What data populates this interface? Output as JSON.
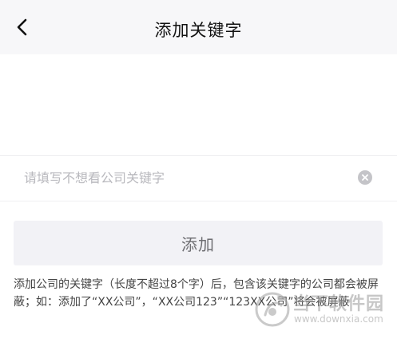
{
  "header": {
    "title": "添加关键字",
    "back_icon": "chevron-left-icon"
  },
  "keyword_input": {
    "value": "",
    "placeholder": "请填写不想看公司关键字",
    "clear_icon": "clear-circle-icon"
  },
  "add_button": {
    "label": "添加"
  },
  "hint": "添加公司的关键字（长度不超过8个字）后，包含该关键字的公司都会被屏蔽；如：添加了“XX公司”，“XX公司123”“123XX公司”将会被屏蔽",
  "watermark": {
    "brand": "当下软件园",
    "url": "www.downxia.com"
  },
  "colors": {
    "header_bg": "#f7f7f9",
    "button_bg": "#f2f2f6",
    "button_text": "#6e6e72",
    "placeholder": "#b9b9be",
    "clear_icon": "#c4c4c8"
  }
}
